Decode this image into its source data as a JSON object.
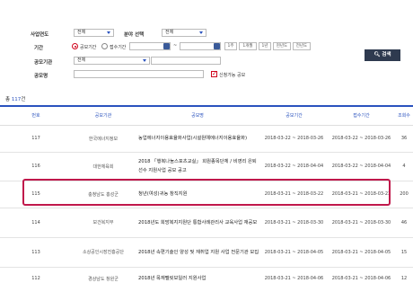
{
  "search": {
    "year_label": "사업연도",
    "year_value": "전체",
    "category_label": "분야 선택",
    "category_value": "전체",
    "period_label": "기간",
    "radio_notice": "공모기간",
    "radio_receipt": "접수기간",
    "date_sep": "~",
    "quick_buttons": [
      "1주",
      "1개월",
      "1년",
      "현년도",
      "전년도"
    ],
    "org_label": "공모기관",
    "org_value": "전체",
    "name_label": "공모명",
    "open_only_label": "신청가능 공모",
    "search_button": "검색"
  },
  "total": {
    "prefix": "총 ",
    "count": "117",
    "suffix": "건"
  },
  "table": {
    "headers": [
      "번호",
      "공모기관",
      "공모명",
      "공모기간",
      "접수기간",
      "조회수"
    ],
    "rows": [
      {
        "no": "117",
        "org": "한국에너지정보",
        "title": "농업에너지이용효율화사업(시설원예에너지이용효율화)",
        "period": "2018-03-22 ~ 2018-03-26",
        "receipt": "2018-03-22 ~ 2018-03-26",
        "views": "36"
      },
      {
        "no": "116",
        "org": "대한체육회",
        "title": "2018 「행복나눔스포츠교실」 회원종목단체 / 비영리 은퇴선수 지원사업 공모 공고",
        "period": "2018-03-22 ~ 2018-04-04",
        "receipt": "2018-03-22 ~ 2018-04-04",
        "views": "4"
      },
      {
        "no": "115",
        "org": "충청남도 홍성군",
        "title": "청년(여성)귀농 창직지원",
        "period": "2018-03-21 ~ 2018-03-22",
        "receipt": "2018-03-21 ~ 2018-03-23",
        "views": "200"
      },
      {
        "no": "114",
        "org": "보건복지부",
        "title": "2018년도 희망복지지원단 통합사례관리사 교육사업 재공모",
        "period": "2018-03-21 ~ 2018-03-30",
        "receipt": "2018-03-21 ~ 2018-03-30",
        "views": "46"
      },
      {
        "no": "113",
        "org": "소상공인시장진흥공단",
        "title": "2018년 속편기술인 양성 및 재취업 지원 사업 전문기관 모집",
        "period": "2018-03-21 ~ 2018-04-05",
        "receipt": "2018-03-21 ~ 2018-04-05",
        "views": "15"
      },
      {
        "no": "112",
        "org": "경상남도 창원군",
        "title": "2018년 목재펠릿보일러 지원사업",
        "period": "2018-03-21 ~ 2018-04-06",
        "receipt": "2018-03-21 ~ 2018-04-06",
        "views": "12"
      }
    ]
  },
  "colors": {
    "accent": "#2a52be",
    "highlight": "#c0184b",
    "search_btn": "#2e3a4f"
  }
}
